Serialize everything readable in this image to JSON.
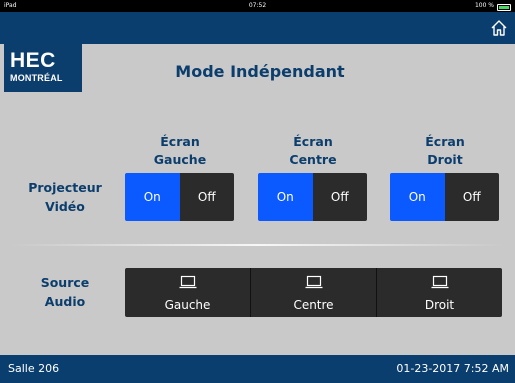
{
  "statusbar": {
    "carrier": "iPad",
    "time": "07:52",
    "battery": "100 %"
  },
  "logo": {
    "line1": "HEC",
    "line2": "MONTRÉAL"
  },
  "page_title": "Mode Indépendant",
  "screens": [
    {
      "line1": "Écran",
      "line2": "Gauche"
    },
    {
      "line1": "Écran",
      "line2": "Centre"
    },
    {
      "line1": "Écran",
      "line2": "Droit"
    }
  ],
  "projector": {
    "label_line1": "Projecteur",
    "label_line2": "Vidéo",
    "on_label": "On",
    "off_label": "Off"
  },
  "audio": {
    "label_line1": "Source",
    "label_line2": "Audio",
    "sources": [
      "Gauche",
      "Centre",
      "Droit"
    ]
  },
  "footer": {
    "room": "Salle 206",
    "datetime": "01-23-2017 7:52 AM"
  },
  "colors": {
    "header_bg": "#0a3e6e",
    "body_bg": "#c9c9c9",
    "accent_on": "#0a5aff",
    "button_dark": "#2b2b2b",
    "title_text": "#0c3e6d"
  },
  "icons": {
    "home": "home-icon",
    "source": "laptop-icon"
  }
}
